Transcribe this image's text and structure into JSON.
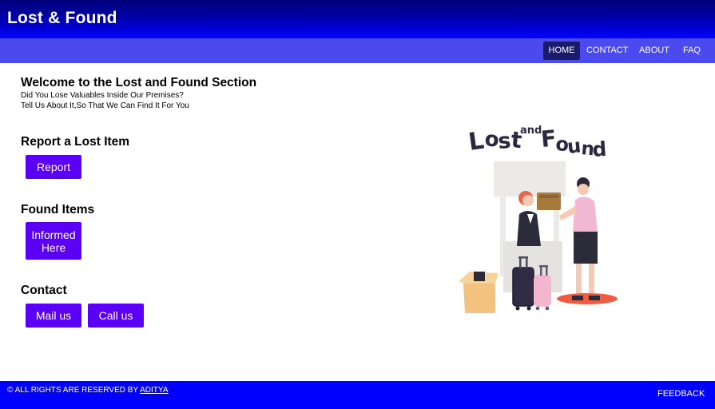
{
  "header": {
    "title": "Lost & Found"
  },
  "nav": {
    "items": [
      "HOME",
      "CONTACT",
      "ABOUT",
      "FAQ"
    ],
    "active": "HOME"
  },
  "welcome": {
    "title": "Welcome to the Lost and Found Section",
    "line1": "Did You Lose Valuables Inside Our Premises?",
    "line2": "Tell Us About It,So That We Can Find It For You"
  },
  "report": {
    "title": "Report a Lost Item",
    "button": "Report"
  },
  "found": {
    "title": "Found Items",
    "button_line1": "Informed",
    "button_line2": "Here"
  },
  "contact": {
    "title": "Contact",
    "mail_button": "Mail us",
    "call_button": "Call us"
  },
  "illustration": {
    "lettering": "Lost and Found"
  },
  "footer": {
    "copyright_prefix": "© ALL RIGHTS ARE RESERVED BY ",
    "author": "ADITYA",
    "feedback": "FEEDBACK"
  },
  "colors": {
    "header_dark": "#00007a",
    "nav_bg": "#4a4aee",
    "nav_active": "#1a1a6e",
    "button": "#5a00f5",
    "footer": "#0000ff"
  }
}
